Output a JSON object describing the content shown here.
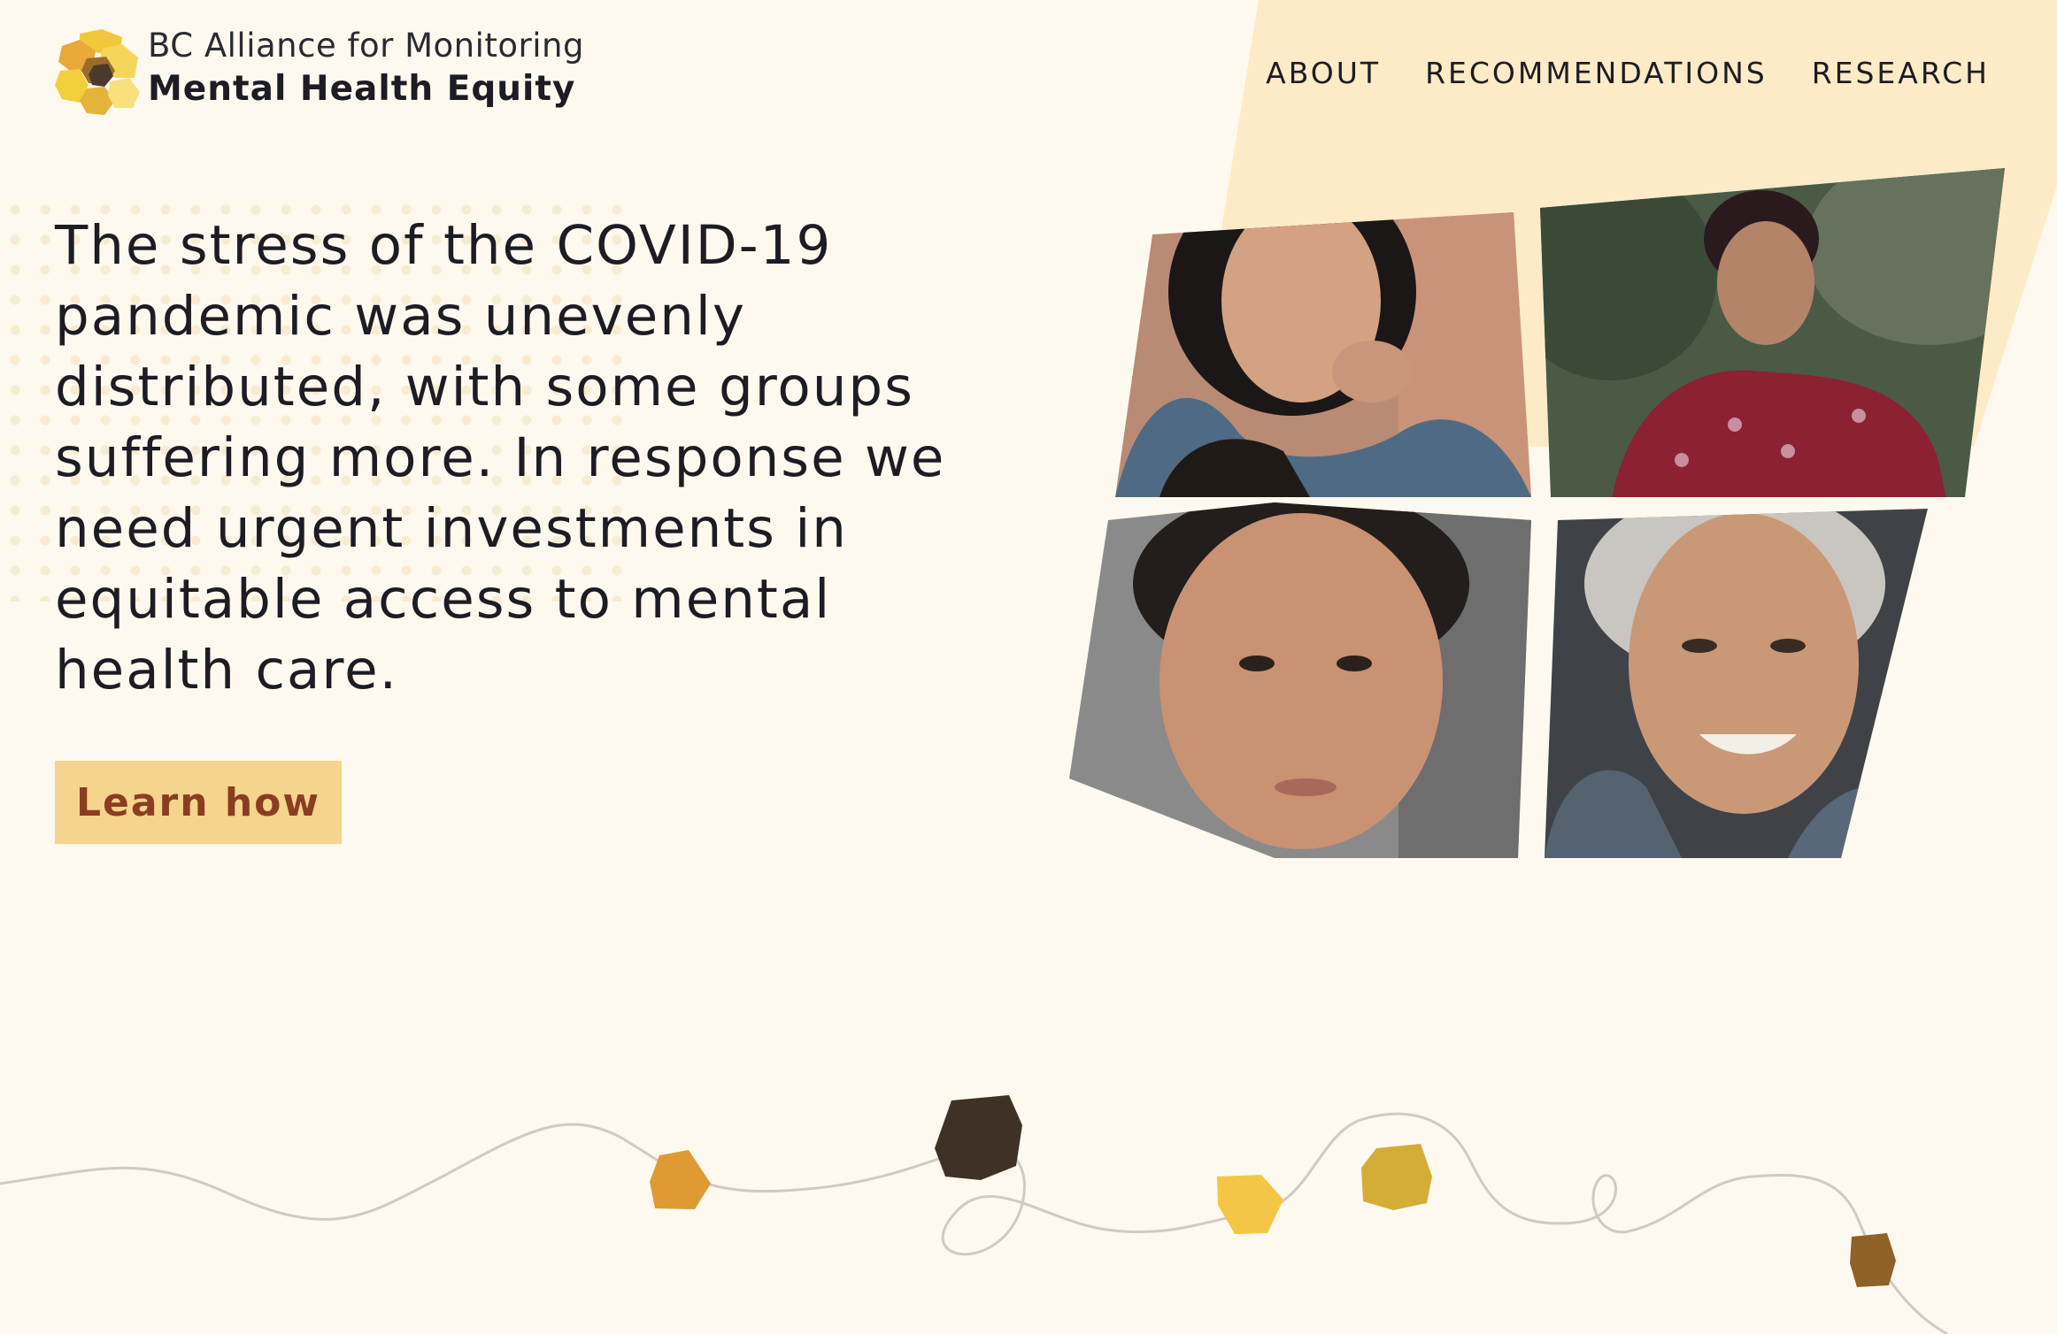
{
  "brand": {
    "line1": "BC Alliance for Monitoring",
    "line2": "Mental Health Equity"
  },
  "nav": {
    "items": [
      "ABOUT",
      "RECOMMENDATIONS",
      "RESEARCH"
    ]
  },
  "hero": {
    "headline": "The stress of the COVID-19 pandemic was unevenly distributed, with some groups suffering more. In response we need urgent investments in equitable access to mental health care.",
    "cta_label": "Learn how"
  },
  "colors": {
    "background": "#fef9ef",
    "panel": "#fcebc6",
    "cta_bg": "#f5d48e",
    "cta_text": "#8b3d22",
    "text": "#1d1c24"
  },
  "photos": [
    {
      "name": "woman-with-hood-photo"
    },
    {
      "name": "man-with-glasses-photo"
    },
    {
      "name": "young-man-portrait-photo"
    },
    {
      "name": "older-woman-smiling-photo"
    }
  ]
}
